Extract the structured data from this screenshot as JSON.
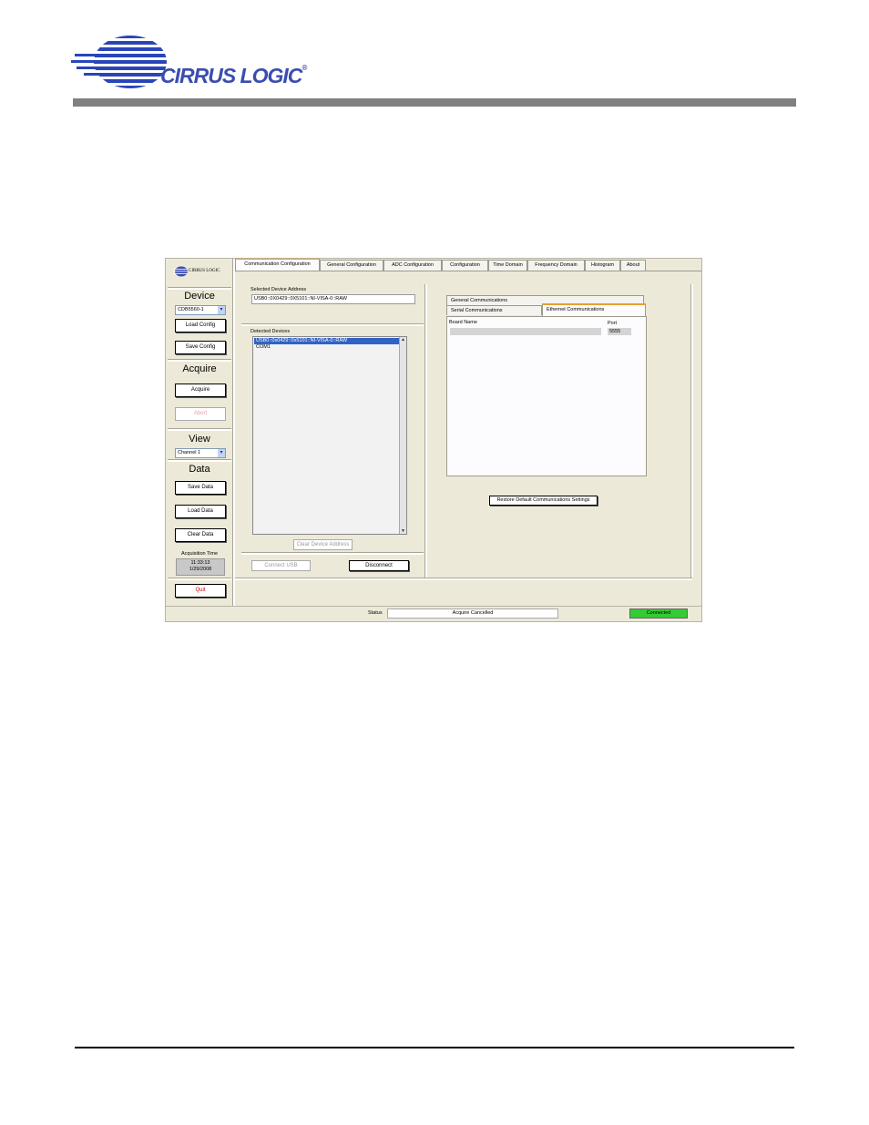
{
  "brand": {
    "name": "CIRRUS LOGIC",
    "reg": "®"
  },
  "app": {
    "logo_text": "CIRRUS LOGIC",
    "device": {
      "title": "Device",
      "selected": "CDB5560-1",
      "load_config": "Load Config",
      "save_config": "Save Config"
    },
    "acquire": {
      "title": "Acquire",
      "acquire_button": "Acquire",
      "abort_button": "Abort"
    },
    "view": {
      "title": "View",
      "channel": "Channel 1"
    },
    "data": {
      "title": "Data",
      "save_data": "Save Data",
      "load_data": "Load Data",
      "clear_data": "Clear Data"
    },
    "acquisition_time": {
      "label": "Acquisition Time",
      "time": "11:33:13",
      "date": "1/29/2008"
    },
    "quit_button": "Quit",
    "tabs": [
      {
        "label": "Communication Configuration"
      },
      {
        "label": "General Configuration"
      },
      {
        "label": "ADC Configuration"
      },
      {
        "label": "Configuration"
      },
      {
        "label": "Time Domain"
      },
      {
        "label": "Frequency Domain"
      },
      {
        "label": "Histogram"
      },
      {
        "label": "About"
      }
    ],
    "comm": {
      "selected_label": "Selected Device Address",
      "selected_value": "USB0::0X0429::0X5101::NI-VISA-0::RAW",
      "detected_label": "Detected Devices",
      "detected_items": [
        "USB0::0x0429::0x5101::NI-VISA-0::RAW",
        "COM1"
      ],
      "clear_address": "Clear Device Address",
      "connect_usb": "Connect USB",
      "disconnect": "Disconnect"
    },
    "comm_tabs": {
      "general": "General Communications",
      "serial": "Serial Communications",
      "ethernet": "Ethernet Communications"
    },
    "ethernet": {
      "board_name_label": "Board Name",
      "board_name_value": "",
      "port_label": "Port",
      "port_value": "5555"
    },
    "restore_button": "Restore Default Communications Settings",
    "status": {
      "label": "Status",
      "value": "Acquire Cancelled",
      "connection": "Connected",
      "connection_color": "#33cc33"
    }
  }
}
